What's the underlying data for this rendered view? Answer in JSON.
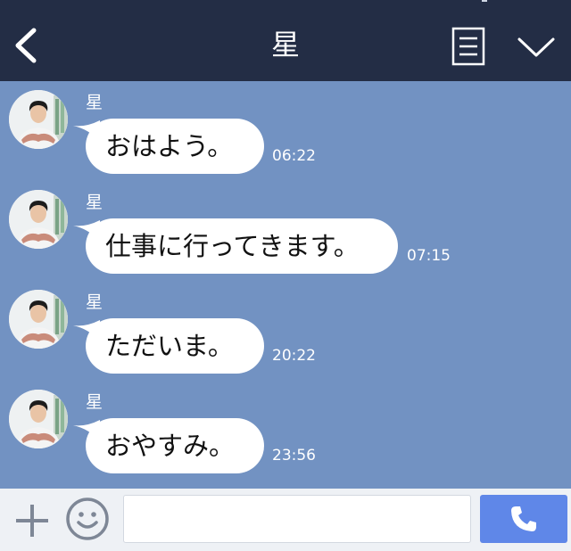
{
  "header": {
    "title": "星",
    "back_icon": "chevron-left-icon",
    "menu_icon": "menu-lines-icon",
    "expand_icon": "chevron-down-icon",
    "background": "#232d45"
  },
  "chat": {
    "background": "#7292c2",
    "messages": [
      {
        "sender": "星",
        "text": "おはよう。",
        "time": "06:22"
      },
      {
        "sender": "星",
        "text": "仕事に行ってきます。",
        "time": "07:15"
      },
      {
        "sender": "星",
        "text": "ただいま。",
        "time": "20:22"
      },
      {
        "sender": "星",
        "text": "おやすみ。",
        "time": "23:56"
      }
    ]
  },
  "footer": {
    "plus_icon": "plus-icon",
    "emoji_icon": "smiley-icon",
    "input_placeholder": "",
    "input_value": "",
    "call_icon": "phone-icon",
    "call_color": "#5f87e8"
  }
}
